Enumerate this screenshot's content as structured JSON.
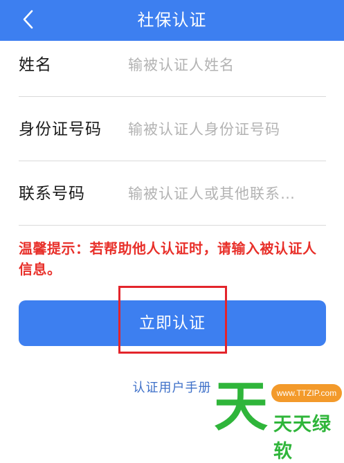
{
  "header": {
    "title": "社保认证",
    "background_color": "#3d7ff0"
  },
  "form": {
    "rows": [
      {
        "label": "姓名",
        "placeholder": "输被认证人姓名",
        "value": ""
      },
      {
        "label": "身份证号码",
        "placeholder": "输被认证人身份证号码",
        "value": ""
      },
      {
        "label": "联系号码",
        "placeholder": "输被认证人或其他联系…",
        "value": ""
      }
    ]
  },
  "tip": "温馨提示：若帮助他人认证时，请输入被认证人信息。",
  "tip_color": "#e8302a",
  "submit_label": "立即认证",
  "manual_link": "认证用户手册",
  "watermark": {
    "logo_char": "天",
    "url": "www.TTZIP.com",
    "name": "天天绿软"
  }
}
